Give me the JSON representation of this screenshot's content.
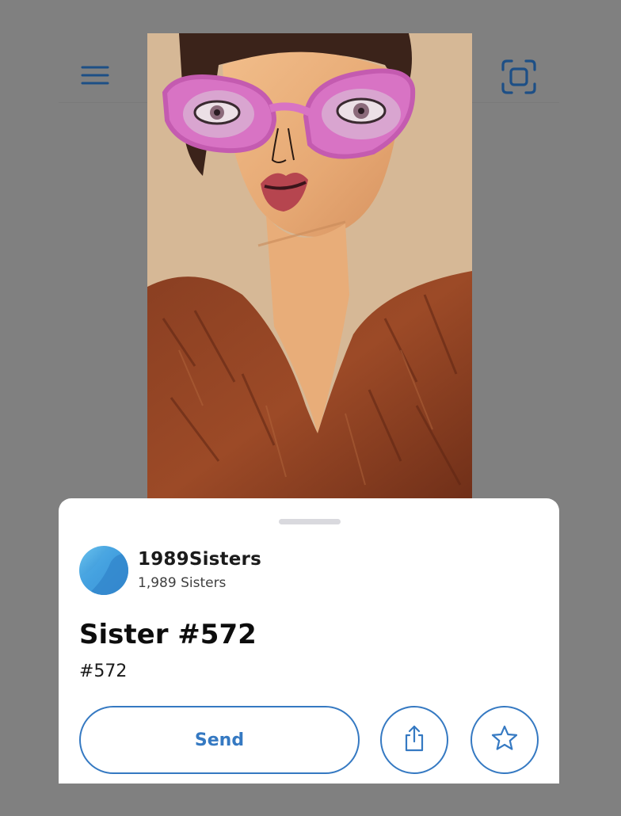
{
  "colors": {
    "overlay": "#808080",
    "accent": "#3579c2",
    "sheet": "#ffffff",
    "icon_dimmed": "#1d4f86"
  },
  "header": {
    "left_icon": "hamburger-menu-icon",
    "right_icon": "scan-frame-icon"
  },
  "artwork": {
    "subject": "illustrated-portrait-pink-sunglasses"
  },
  "sheet": {
    "collection": {
      "name": "1989Sisters",
      "count_label": "1,989 Sisters",
      "avatar_icon": "collection-avatar"
    },
    "item": {
      "title": "Sister #572",
      "subtitle": "#572"
    },
    "actions": {
      "send_label": "Send",
      "share_icon": "share-icon",
      "favorite_icon": "star-icon"
    }
  }
}
